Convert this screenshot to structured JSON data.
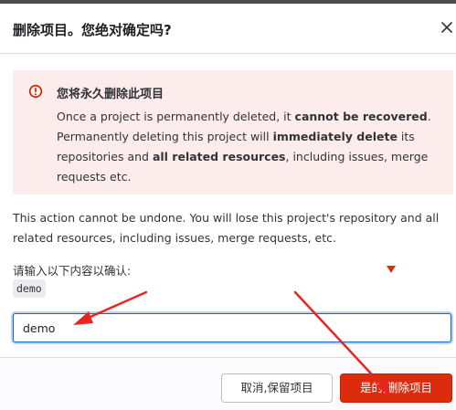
{
  "dialog": {
    "title": "删除项目。您绝对确定吗?",
    "close_icon": "close-icon"
  },
  "alert": {
    "icon": "exclamation-circle-icon",
    "title": "您将永久删除此项目",
    "body": {
      "p1": "Once a project is permanently deleted, it ",
      "b1": "cannot be recovered",
      "p2": ". Permanently deleting this project will ",
      "b2": "immediately delete",
      "p3": " its repositories and ",
      "b3": "all related resources",
      "p4": ", including issues, merge requests etc."
    }
  },
  "description": "This action cannot be undone. You will lose this project's repository and all related resources, including issues, merge requests, etc.",
  "confirm": {
    "label": "请输入以下内容以确认:",
    "code": "demo",
    "input_value": "demo"
  },
  "buttons": {
    "cancel": "取消,保留项目",
    "confirm_delete": "是的,删除项目"
  },
  "colors": {
    "danger": "#dd2b0e",
    "alert_bg": "#fdecec",
    "focus": "#1068bf",
    "annotation_arrow": "#e8251f"
  }
}
